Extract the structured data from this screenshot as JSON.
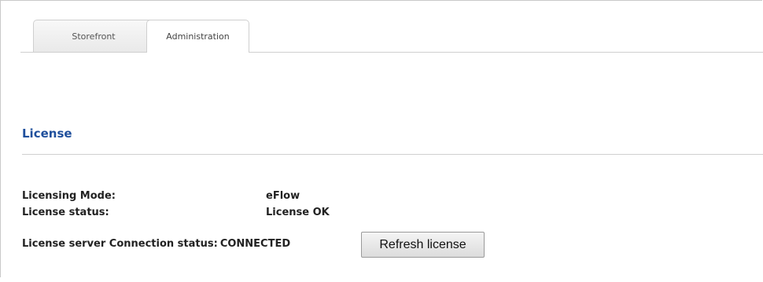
{
  "tabs": [
    {
      "label": "Storefront",
      "active": false
    },
    {
      "label": "Administration",
      "active": true
    }
  ],
  "section": {
    "title": "License"
  },
  "license": {
    "mode_label": "Licensing Mode:",
    "mode_value": "eFlow",
    "status_label": "License status:",
    "status_value": "License OK",
    "connection_label": "License server Connection status:",
    "connection_value": "CONNECTED",
    "refresh_button": "Refresh license"
  },
  "colors": {
    "section_title": "#1f4f9c",
    "border": "#cfcfcf"
  }
}
